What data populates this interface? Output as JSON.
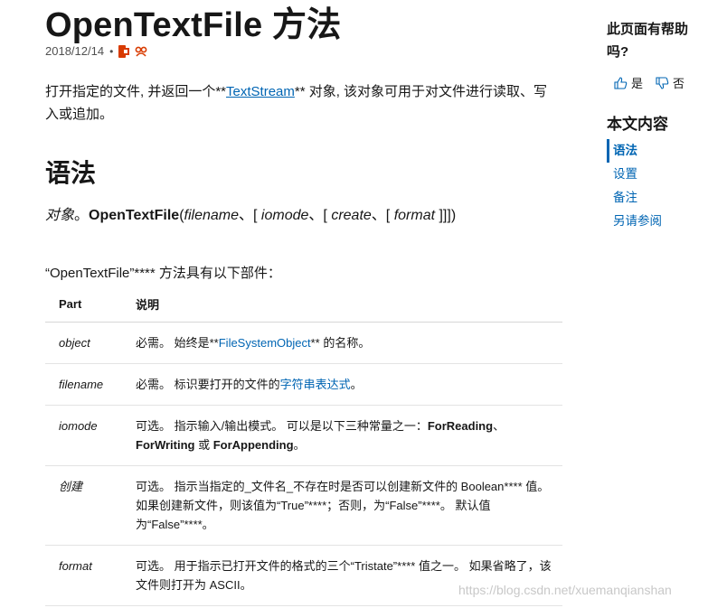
{
  "page": {
    "title": "OpenTextFile 方法",
    "date": "2018/12/14",
    "dot": "•"
  },
  "intro": {
    "before": "打开指定的文件, 并返回一个**",
    "link": "TextStream",
    "after": "** 对象, 该对象可用于对文件进行读取、写入或追加。"
  },
  "syntax_section": {
    "heading": "语法",
    "object": "对象",
    "sep1": "。",
    "method": "OpenTextFile",
    "open": "(",
    "filename": "filename",
    "comma1": "、[ ",
    "iomode": "iomode",
    "comma2": "、[ ",
    "create": "create",
    "comma3": "、[ ",
    "format": "format",
    "close": " ]]])"
  },
  "parts_intro": "“OpenTextFile”**** 方法具有以下部件：",
  "table": {
    "headers": [
      "Part",
      "说明"
    ],
    "rows": [
      {
        "part": "object",
        "desc_before": "必需。 始终是**",
        "desc_link": "FileSystemObject",
        "desc_after": "** 的名称。"
      },
      {
        "part": "filename",
        "desc_before": "必需。 标识要打开的文件的",
        "desc_link": "字符串表达式",
        "desc_after": "。"
      },
      {
        "part": "iomode",
        "desc_before": "可选。 指示输入/输出模式。 可以是以下三种常量之一：",
        "b1": "ForReading",
        "mid1": "、",
        "b2": "ForWriting",
        "mid2": " 或 ",
        "b3": "ForAppending",
        "desc_after": "。"
      },
      {
        "part": "创建",
        "desc": "可选。 指示当指定的_文件名_不存在时是否可以创建新文件的 Boolean**** 值。 如果创建新文件，则该值为“True”****；否则，为“False”****。 默认值为“False”****。"
      },
      {
        "part": "format",
        "desc": "可选。 用于指示已打开文件的格式的三个“Tristate”**** 值之一。 如果省略了，该文件则打开为 ASCII。"
      }
    ]
  },
  "sidebar": {
    "feedback_question": "此页面有帮助吗?",
    "yes_label": "是",
    "no_label": "否",
    "toc_heading": "本文内容",
    "toc_items": [
      "语法",
      "设置",
      "备注",
      "另请参阅"
    ]
  },
  "watermark": "https://blog.csdn.net/xuemanqianshan",
  "colors": {
    "link": "#0065b3",
    "office": "#d83b01",
    "text": "#171717"
  }
}
